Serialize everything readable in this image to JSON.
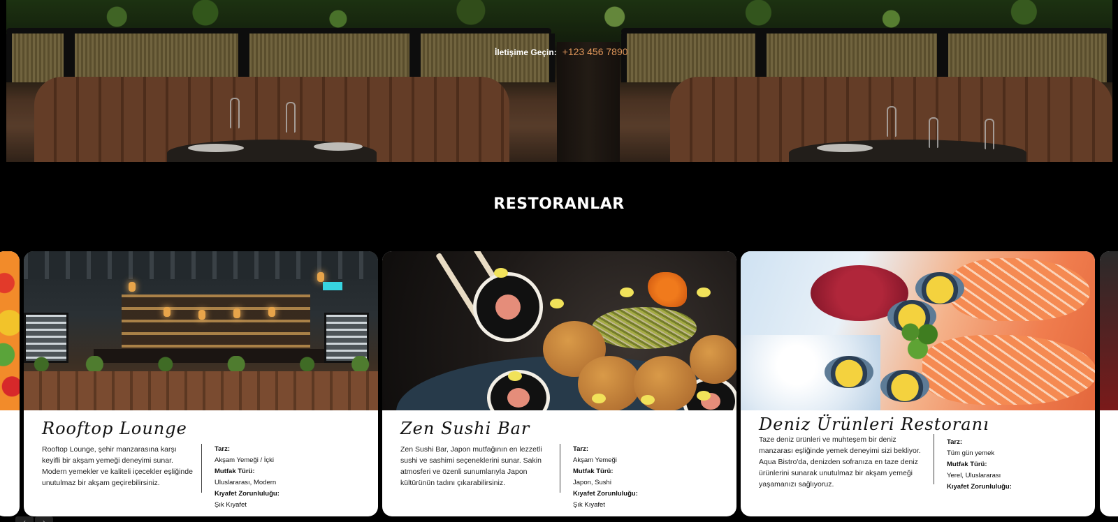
{
  "hero": {
    "contact_label": "İletişime Geçin:",
    "contact_phone": "+123 456 7890"
  },
  "section": {
    "title": "RESTORANLAR"
  },
  "restaurants": [
    {
      "name": "Rooftop Lounge",
      "description": "Rooftop Lounge, şehir manzarasına karşı keyifli bir akşam yemeği deneyimi sunar. Modern yemekler ve kaliteli içecekler eşliğinde unutulmaz bir akşam geçirebilirsiniz.",
      "style_label": "Tarz:",
      "style_value": "Akşam Yemeği / İçki",
      "cuisine_label": "Mutfak Türü:",
      "cuisine_value": "Uluslararası, Modern",
      "dress_label": "Kıyafet Zorunluluğu:",
      "dress_value": "Şık Kıyafet"
    },
    {
      "name": "Zen Sushi Bar",
      "description": "Zen Sushi Bar, Japon mutfağının en lezzetli sushi ve sashimi seçeneklerini sunar. Sakin atmosferi ve özenli sunumlarıyla Japon kültürünün tadını çıkarabilirsiniz.",
      "style_label": "Tarz:",
      "style_value": "Akşam Yemeği",
      "cuisine_label": "Mutfak Türü:",
      "cuisine_value": "Japon, Sushi",
      "dress_label": "Kıyafet Zorunluluğu:",
      "dress_value": "Şık Kıyafet"
    },
    {
      "name": "Deniz Ürünleri Restoranı",
      "description": "Taze deniz ürünleri ve muhteşem bir deniz manzarası eşliğinde yemek deneyimi sizi bekliyor. Aqua Bistro'da, denizden sofranıza en taze deniz ürünlerini sunarak unutulmaz bir akşam yemeği yaşamanızı sağlıyoruz.",
      "style_label": "Tarz:",
      "style_value": "Tüm gün yemek",
      "cuisine_label": "Mutfak Türü:",
      "cuisine_value": "Yerel, Uluslararası",
      "dress_label": "Kıyafet Zorunluluğu:",
      "dress_value": ""
    }
  ],
  "nav": {
    "prev": "‹",
    "next": "›"
  },
  "colors": {
    "accent_phone": "#e0975a",
    "background": "#000000",
    "card": "#ffffff"
  }
}
